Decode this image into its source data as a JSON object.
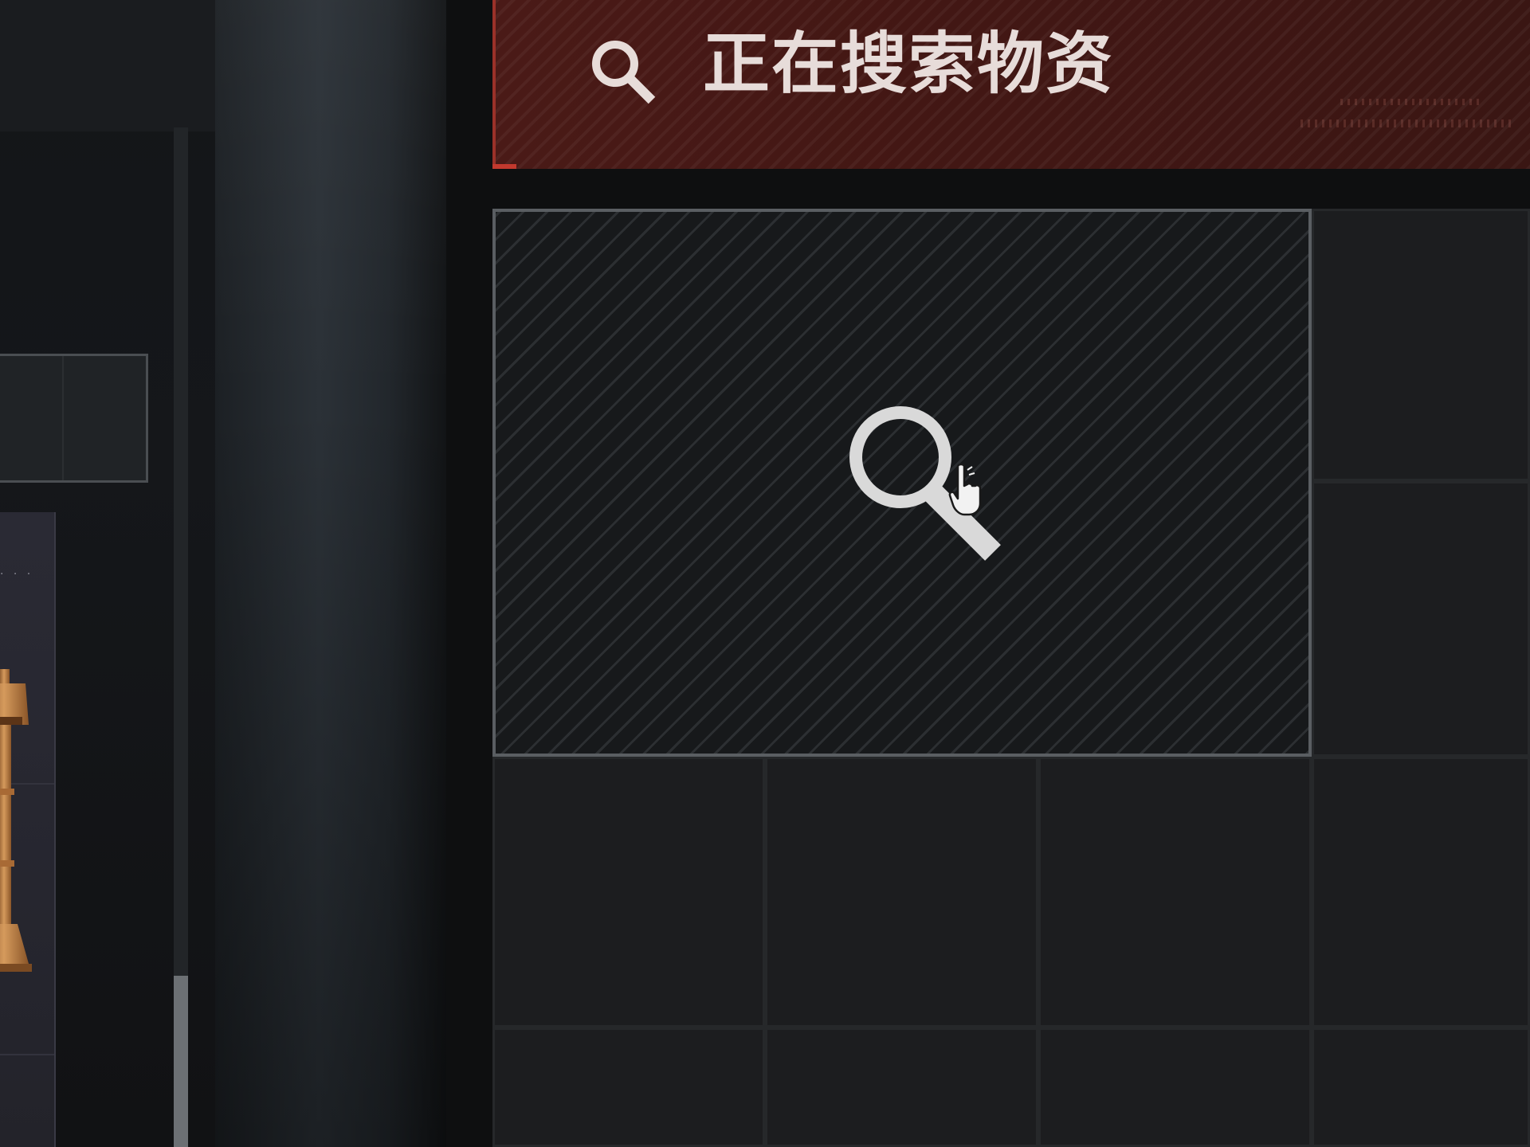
{
  "banner": {
    "title": "正在搜索物资",
    "icon": "search-icon"
  },
  "searching_slot": {
    "icon": "magnifier-search-icon",
    "state": "searching"
  },
  "left_panel": {
    "item_card": {
      "dots": "· · ·",
      "icon": "lamp-artifact-icon"
    }
  },
  "colors": {
    "banner_background": "#4a1a17",
    "banner_accent": "#c2392e",
    "banner_text": "#e7dcd9",
    "slot_border": "#5a5e62",
    "grid_cell": "#1c1d1f"
  }
}
